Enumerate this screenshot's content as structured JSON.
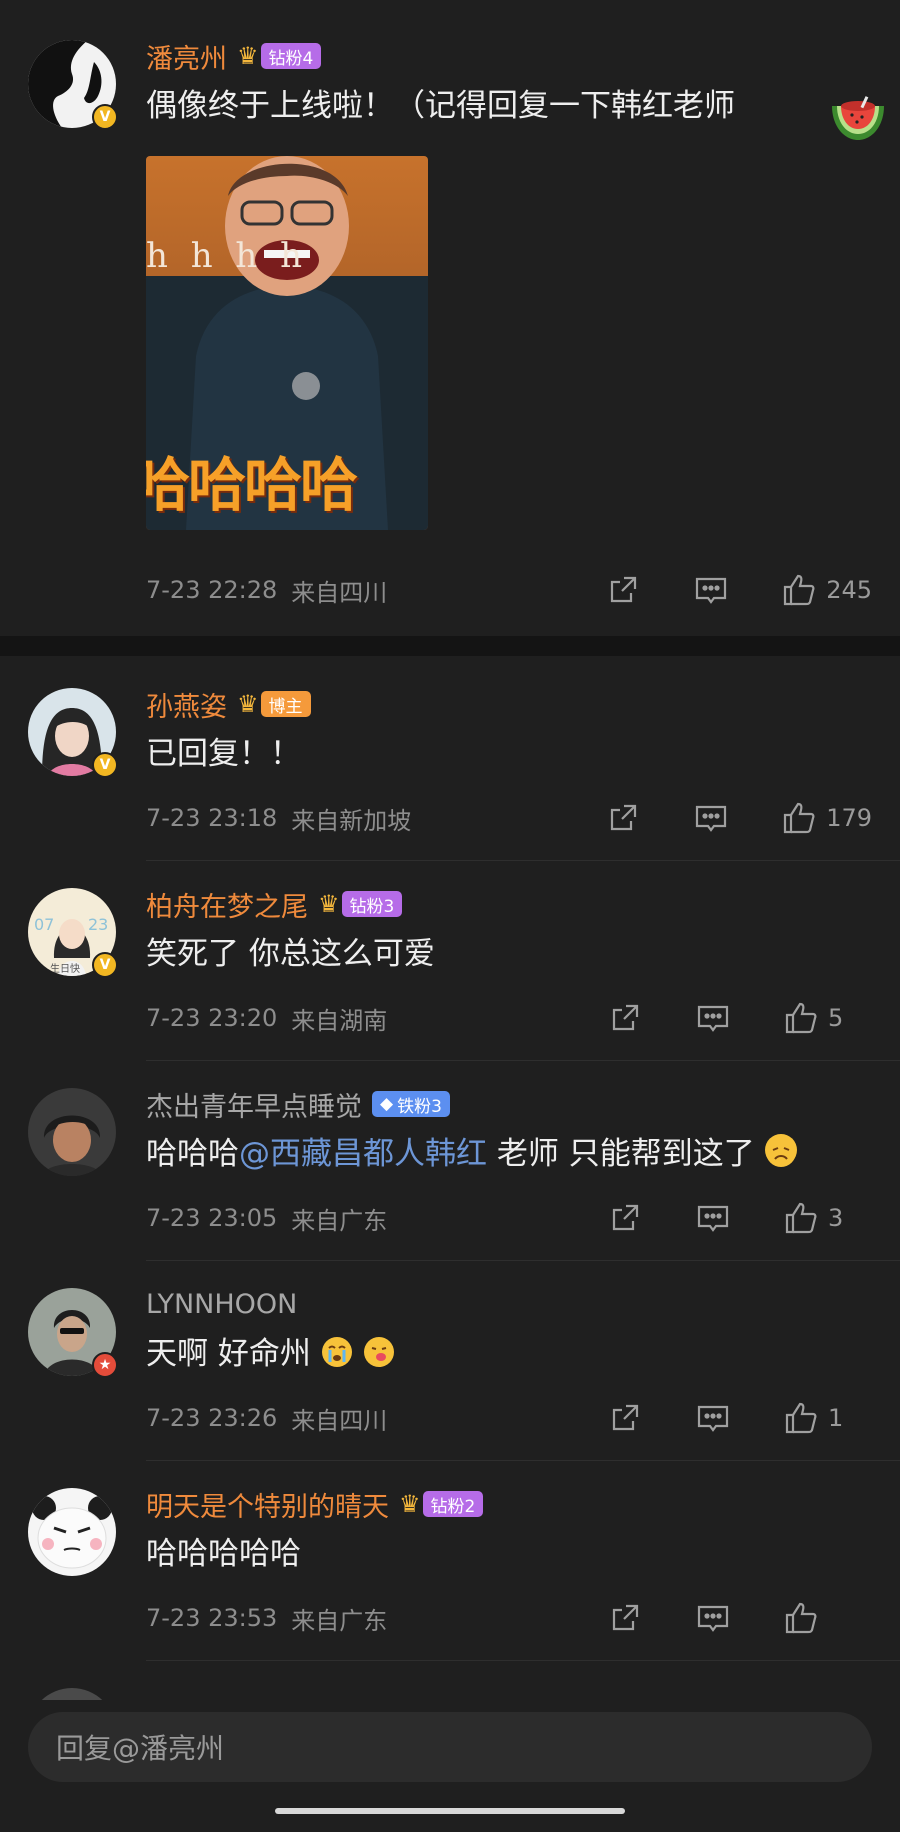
{
  "main_comment": {
    "name": "潘亮州",
    "badge": "钻粉4",
    "text": "偶像终于上线啦！（记得回复一下韩红老师",
    "image_caption": "哈哈哈哈",
    "image_overlay": "h h h h",
    "time": "7-23 22:28",
    "location": "来自四川",
    "likes": "245"
  },
  "replies": [
    {
      "name": "孙燕姿",
      "badge": "博主",
      "text": "已回复！！",
      "time": "7-23 23:18",
      "location": "来自新加坡",
      "likes": "179"
    },
    {
      "name": "柏舟在梦之尾",
      "badge": "钻粉3",
      "text": "笑死了 你总这么可爱",
      "time": "7-23 23:20",
      "location": "来自湖南",
      "likes": "5"
    },
    {
      "name": "杰出青年早点睡觉",
      "badge": "铁粉3",
      "text_before": "哈哈哈",
      "mention": "@西藏昌都人韩红",
      "text_after": " 老师 只能帮到这了",
      "time": "7-23 23:05",
      "location": "来自广东",
      "likes": "3"
    },
    {
      "name": "LYNNHOON",
      "text": "天啊 好命州",
      "time": "7-23 23:26",
      "location": "来自四川",
      "likes": "1"
    },
    {
      "name": "明天是个特别的晴天",
      "badge": "钻粉2",
      "text": "哈哈哈哈哈",
      "time": "7-23 23:53",
      "location": "来自广东",
      "likes": ""
    }
  ],
  "reply_input": {
    "placeholder": "回复@潘亮州"
  },
  "colors": {
    "background": "#1f1f1f",
    "name_orange": "#ef8a3c",
    "mention_blue": "#6d96d6",
    "fan_purple": "#b66ce8",
    "fan_orange": "#f59a3b",
    "fan_blue": "#5c8ff0"
  }
}
